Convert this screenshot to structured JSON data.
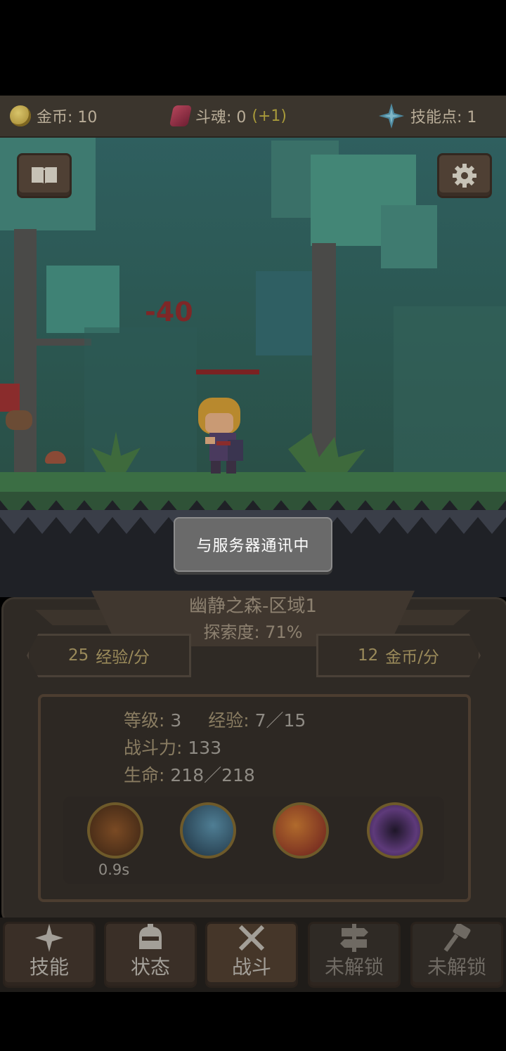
{
  "topbar": {
    "gold_label": "金币: 10",
    "soul_label": "斗魂: 0",
    "soul_bonus": "(+1)",
    "skill_points_label": "技能点: 1"
  },
  "scene": {
    "damage_text": "-40"
  },
  "toast": {
    "message": "与服务器通讯中"
  },
  "zone": {
    "name": "幽静之森-区域1",
    "progress": "探索度: 71%",
    "exp_rate": "25",
    "exp_rate_unit": "经验/分",
    "gold_rate": "12",
    "gold_rate_unit": "金币/分"
  },
  "stats": {
    "level_label": "等级:",
    "level_value": "3",
    "exp_label": "经验:",
    "exp_value": "7／15",
    "power_label": "战斗力:",
    "power_value": "133",
    "hp_label": "生命:",
    "hp_value": "218／218"
  },
  "skills": {
    "cooldown": "0.9s"
  },
  "nav": {
    "tabs": [
      {
        "label": "技能",
        "icon": "sparkle-icon"
      },
      {
        "label": "状态",
        "icon": "helmet-icon"
      },
      {
        "label": "战斗",
        "icon": "crossed-swords-icon"
      },
      {
        "label": "未解锁",
        "icon": "signpost-icon"
      },
      {
        "label": "未解锁",
        "icon": "hammer-icon"
      }
    ]
  }
}
